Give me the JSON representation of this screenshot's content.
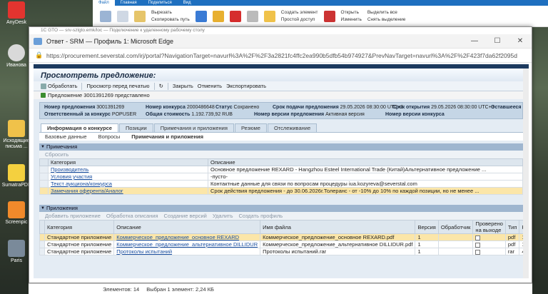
{
  "desktop": {
    "icons": [
      {
        "label": "AnyDesk"
      },
      {
        "label": "Иванова"
      },
      {
        "label": "Исходящие письма ..."
      },
      {
        "label": "SumatraPDF"
      },
      {
        "label": "Screenpic"
      },
      {
        "label": "Paris"
      }
    ]
  },
  "ribbon": {
    "tabs": [
      "Файл",
      "Главная",
      "Поделиться",
      "Вид"
    ],
    "cut": "Вырезать",
    "copy_path": "Скопировать путь",
    "new_item": "Создать элемент",
    "easy_access": "Простой доступ",
    "open": "Открыть",
    "edit": "Изменить",
    "select_all": "Выделить все",
    "deselect": "Снять выделение"
  },
  "window": {
    "rdp_title": "1С GTO — srv-szlgto.emk/loc — Подключение к удаленному рабочему столу",
    "title": "Ответ - SRM — Профиль 1: Microsoft Edge",
    "url": "https://procurement.severstal.com/irj/portal?NavigationTarget=navurl%3A%2F%2F3a2821fc4ffc2ea990b5dfb54b974927&PrevNavTarget=navurl%3A%2F%2F423f7da62f2095d0aa31db5954c90614"
  },
  "page": {
    "title": "Просмотреть предложение:",
    "toolbar": [
      "Обработать",
      "Просмотр перед печатью",
      "Закрыть",
      "Отменить",
      "Экспортировать"
    ],
    "message": "Предложение 3001391269 представлено",
    "header": {
      "offer_no_label": "Номер предложения",
      "offer_no": "3001391269",
      "resp_label": "Ответственный за конкурс",
      "resp": "POPUSER",
      "tender_no_label": "Номер конкурса",
      "tender_no": "2000486648",
      "total_label": "Общая стоимость",
      "total": "1.192.739,92 RUB",
      "status_label": "Статус",
      "status": "Сохранено",
      "deadline_label": "Срок подачи предложения",
      "deadline": "29.05.2026 08:30:00 UTC+3",
      "version_label": "Номер версии предложения",
      "version": "Активная версия",
      "deadline2_label": "Срок открытия",
      "deadline2": "29.05.2026 08:30:00 UTC+3",
      "tender_version_label": "Номер версии конкурса",
      "remaining_label": "Оставшееся"
    },
    "tabs1": [
      "Информация о конкурсе",
      "Позиции",
      "Примечания и приложения",
      "Резюме",
      "Отслеживание"
    ],
    "tabs2": [
      "Базовые данные",
      "Вопросы",
      "Примечания и приложения"
    ],
    "notes": {
      "title": "Примечания",
      "tool": "Сбросить",
      "columns": [
        "Категория",
        "Описание"
      ],
      "rows": [
        {
          "category": "Производитель",
          "desc": "Основное предложение REXARD - Hangzhou Esteel International Trade (Китай)Альтернативное предложение ..."
        },
        {
          "category": "Условия участия",
          "desc": "-пусто-"
        },
        {
          "category": "Текст аукциона/конкурса",
          "desc": "Контактные данные для связи по вопросам процедуры iua.kozyreva@severstal.com"
        },
        {
          "category": "Замечания оферента/Аналог",
          "desc": "Срок действия предложения - до 30.06.2026г.Толеранс - от -10% до 10% по каждой позиции, но не менее ..."
        }
      ]
    },
    "attachments": {
      "title": "Приложения",
      "tools": [
        "Добавить приложение",
        "Обработка описания",
        "Создание версий",
        "Удалить",
        "Создать профиль"
      ],
      "columns": [
        "Категория",
        "Описание",
        "Имя файла",
        "Версия",
        "Обработчик",
        "Проверено на выходе",
        "Тип",
        "Размер"
      ],
      "rows": [
        {
          "category": "Стандартное приложение",
          "desc": "Коммерческое_предложение_основное REXARD",
          "file": "Коммерческое_предложение_основное REXARD.pdf",
          "version": "1",
          "type": "pdf",
          "size": "156"
        },
        {
          "category": "Стандартное приложение",
          "desc": "Коммерческое_предложение_альтернативное DILLIDUR",
          "file": "Коммерческое_предложение_альтернативное DILLIDUR.pdf",
          "version": "1",
          "type": "pdf",
          "size": "156"
        },
        {
          "category": "Стандартное приложение",
          "desc": "Протоколы испытаний",
          "file": "Протоколы испытаний.rar",
          "version": "1",
          "type": "rar",
          "size": "4426"
        }
      ]
    }
  },
  "statusbar": {
    "items": "Элементов: 14",
    "selected": "Выбран 1 элемент: 2,24 КБ"
  }
}
